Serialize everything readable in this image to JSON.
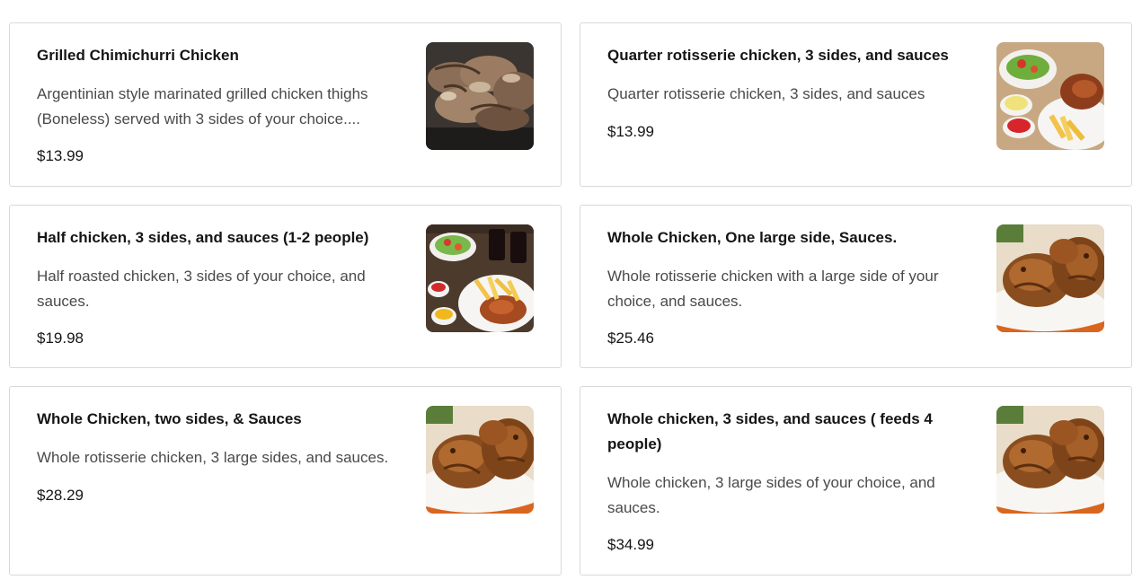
{
  "menu": {
    "items": [
      {
        "name": "Grilled Chimichurri Chicken",
        "description": "Argentinian style marinated grilled chicken thighs (Boneless) served with 3 sides of your choice....",
        "price": "$13.99",
        "image": "grilled-chicken-thighs-photo"
      },
      {
        "name": "Quarter rotisserie chicken, 3 sides, and sauces",
        "description": "Quarter rotisserie chicken, 3 sides, and sauces",
        "price": "$13.99",
        "image": "quarter-chicken-plate-photo"
      },
      {
        "name": "Half chicken, 3 sides, and sauces (1-2 people)",
        "description": "Half roasted chicken, 3 sides of your choice, and sauces.",
        "price": "$19.98",
        "image": "half-chicken-plate-photo"
      },
      {
        "name": "Whole Chicken, One large side, Sauces.",
        "description": "Whole rotisserie chicken with a large side of your choice, and sauces.",
        "price": "$25.46",
        "image": "whole-chicken-photo"
      },
      {
        "name": "Whole Chicken, two sides, & Sauces",
        "description": "Whole rotisserie chicken, 3 large sides, and sauces.",
        "price": "$28.29",
        "image": "whole-chicken-photo"
      },
      {
        "name": "Whole chicken, 3 sides, and sauces ( feeds 4 people)",
        "description": "Whole chicken, 3 large sides of your choice, and sauces.",
        "price": "$34.99",
        "image": "whole-chicken-photo"
      }
    ]
  }
}
